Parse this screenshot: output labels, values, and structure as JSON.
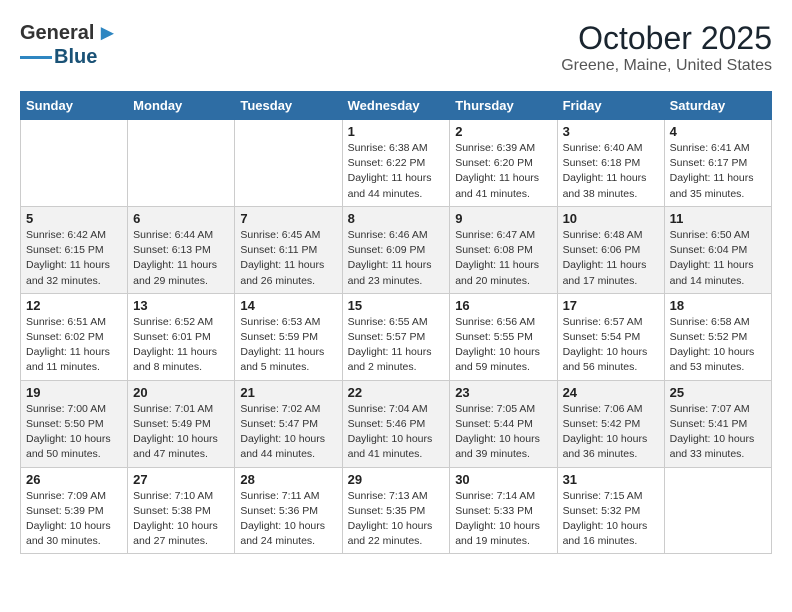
{
  "header": {
    "logo_general": "General",
    "logo_blue": "Blue",
    "month_title": "October 2025",
    "subtitle": "Greene, Maine, United States"
  },
  "weekdays": [
    "Sunday",
    "Monday",
    "Tuesday",
    "Wednesday",
    "Thursday",
    "Friday",
    "Saturday"
  ],
  "weeks": [
    [
      {
        "day": "",
        "info": ""
      },
      {
        "day": "",
        "info": ""
      },
      {
        "day": "",
        "info": ""
      },
      {
        "day": "1",
        "info": "Sunrise: 6:38 AM\nSunset: 6:22 PM\nDaylight: 11 hours\nand 44 minutes."
      },
      {
        "day": "2",
        "info": "Sunrise: 6:39 AM\nSunset: 6:20 PM\nDaylight: 11 hours\nand 41 minutes."
      },
      {
        "day": "3",
        "info": "Sunrise: 6:40 AM\nSunset: 6:18 PM\nDaylight: 11 hours\nand 38 minutes."
      },
      {
        "day": "4",
        "info": "Sunrise: 6:41 AM\nSunset: 6:17 PM\nDaylight: 11 hours\nand 35 minutes."
      }
    ],
    [
      {
        "day": "5",
        "info": "Sunrise: 6:42 AM\nSunset: 6:15 PM\nDaylight: 11 hours\nand 32 minutes."
      },
      {
        "day": "6",
        "info": "Sunrise: 6:44 AM\nSunset: 6:13 PM\nDaylight: 11 hours\nand 29 minutes."
      },
      {
        "day": "7",
        "info": "Sunrise: 6:45 AM\nSunset: 6:11 PM\nDaylight: 11 hours\nand 26 minutes."
      },
      {
        "day": "8",
        "info": "Sunrise: 6:46 AM\nSunset: 6:09 PM\nDaylight: 11 hours\nand 23 minutes."
      },
      {
        "day": "9",
        "info": "Sunrise: 6:47 AM\nSunset: 6:08 PM\nDaylight: 11 hours\nand 20 minutes."
      },
      {
        "day": "10",
        "info": "Sunrise: 6:48 AM\nSunset: 6:06 PM\nDaylight: 11 hours\nand 17 minutes."
      },
      {
        "day": "11",
        "info": "Sunrise: 6:50 AM\nSunset: 6:04 PM\nDaylight: 11 hours\nand 14 minutes."
      }
    ],
    [
      {
        "day": "12",
        "info": "Sunrise: 6:51 AM\nSunset: 6:02 PM\nDaylight: 11 hours\nand 11 minutes."
      },
      {
        "day": "13",
        "info": "Sunrise: 6:52 AM\nSunset: 6:01 PM\nDaylight: 11 hours\nand 8 minutes."
      },
      {
        "day": "14",
        "info": "Sunrise: 6:53 AM\nSunset: 5:59 PM\nDaylight: 11 hours\nand 5 minutes."
      },
      {
        "day": "15",
        "info": "Sunrise: 6:55 AM\nSunset: 5:57 PM\nDaylight: 11 hours\nand 2 minutes."
      },
      {
        "day": "16",
        "info": "Sunrise: 6:56 AM\nSunset: 5:55 PM\nDaylight: 10 hours\nand 59 minutes."
      },
      {
        "day": "17",
        "info": "Sunrise: 6:57 AM\nSunset: 5:54 PM\nDaylight: 10 hours\nand 56 minutes."
      },
      {
        "day": "18",
        "info": "Sunrise: 6:58 AM\nSunset: 5:52 PM\nDaylight: 10 hours\nand 53 minutes."
      }
    ],
    [
      {
        "day": "19",
        "info": "Sunrise: 7:00 AM\nSunset: 5:50 PM\nDaylight: 10 hours\nand 50 minutes."
      },
      {
        "day": "20",
        "info": "Sunrise: 7:01 AM\nSunset: 5:49 PM\nDaylight: 10 hours\nand 47 minutes."
      },
      {
        "day": "21",
        "info": "Sunrise: 7:02 AM\nSunset: 5:47 PM\nDaylight: 10 hours\nand 44 minutes."
      },
      {
        "day": "22",
        "info": "Sunrise: 7:04 AM\nSunset: 5:46 PM\nDaylight: 10 hours\nand 41 minutes."
      },
      {
        "day": "23",
        "info": "Sunrise: 7:05 AM\nSunset: 5:44 PM\nDaylight: 10 hours\nand 39 minutes."
      },
      {
        "day": "24",
        "info": "Sunrise: 7:06 AM\nSunset: 5:42 PM\nDaylight: 10 hours\nand 36 minutes."
      },
      {
        "day": "25",
        "info": "Sunrise: 7:07 AM\nSunset: 5:41 PM\nDaylight: 10 hours\nand 33 minutes."
      }
    ],
    [
      {
        "day": "26",
        "info": "Sunrise: 7:09 AM\nSunset: 5:39 PM\nDaylight: 10 hours\nand 30 minutes."
      },
      {
        "day": "27",
        "info": "Sunrise: 7:10 AM\nSunset: 5:38 PM\nDaylight: 10 hours\nand 27 minutes."
      },
      {
        "day": "28",
        "info": "Sunrise: 7:11 AM\nSunset: 5:36 PM\nDaylight: 10 hours\nand 24 minutes."
      },
      {
        "day": "29",
        "info": "Sunrise: 7:13 AM\nSunset: 5:35 PM\nDaylight: 10 hours\nand 22 minutes."
      },
      {
        "day": "30",
        "info": "Sunrise: 7:14 AM\nSunset: 5:33 PM\nDaylight: 10 hours\nand 19 minutes."
      },
      {
        "day": "31",
        "info": "Sunrise: 7:15 AM\nSunset: 5:32 PM\nDaylight: 10 hours\nand 16 minutes."
      },
      {
        "day": "",
        "info": ""
      }
    ]
  ]
}
